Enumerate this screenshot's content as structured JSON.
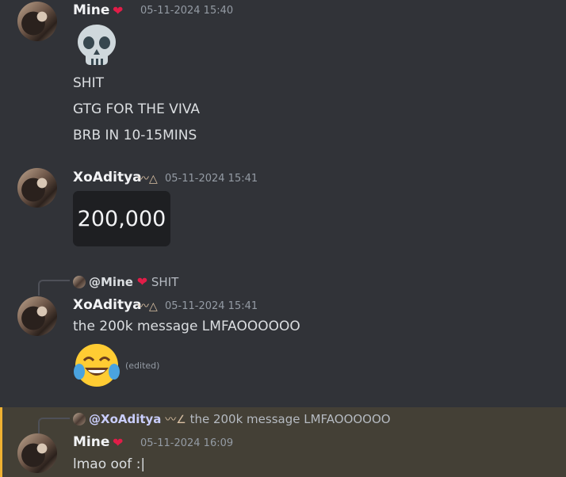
{
  "messages": [
    {
      "author": "Mine",
      "timestamp": "05-11-2024 15:40",
      "emoji_icon": "skull-emoji",
      "lines": [
        "SHIT",
        "GTG FOR THE VIVA",
        "BRB IN 10-15MINS"
      ]
    },
    {
      "author": "XoAditya",
      "timestamp": "05-11-2024 15:41",
      "embed_text": "200,000"
    },
    {
      "reply": {
        "mention": "@Mine",
        "text": "SHIT"
      },
      "author": "XoAditya",
      "timestamp": "05-11-2024 15:41",
      "text": "the 200k message LMFAOOOOOO",
      "emoji_icon": "face-with-tears-of-joy-emoji",
      "edited": "(edited)"
    },
    {
      "reply": {
        "mention": "@XoAditya",
        "text": "the 200k message LMFAOOOOOO"
      },
      "author": "Mine",
      "timestamp": "05-11-2024 16:09",
      "text": "lmao oof :|"
    }
  ],
  "colors": {
    "background": "#313338",
    "highlight": "#444036",
    "highlight_border": "#f0b232",
    "heart": "#e11d48"
  }
}
